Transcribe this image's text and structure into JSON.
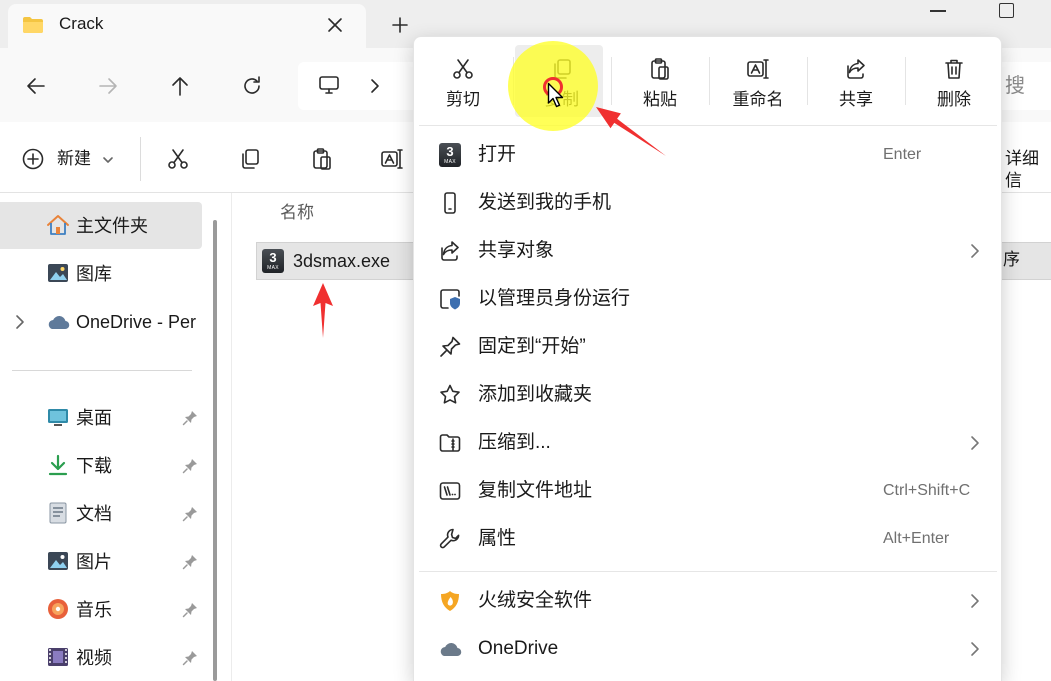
{
  "window": {
    "tab_title": "Crack"
  },
  "nav": {
    "search_placeholder": "搜"
  },
  "toolbar": {
    "new_label": "新建",
    "details_label": "详细信"
  },
  "sidebar": {
    "home": "主文件夹",
    "gallery": "图库",
    "onedrive": "OneDrive - Per",
    "pinned": [
      {
        "label": "桌面",
        "icon": "desktop-icon"
      },
      {
        "label": "下载",
        "icon": "download-icon"
      },
      {
        "label": "文档",
        "icon": "documents-icon"
      },
      {
        "label": "图片",
        "icon": "pictures-icon"
      },
      {
        "label": "音乐",
        "icon": "music-icon"
      },
      {
        "label": "视频",
        "icon": "videos-icon"
      }
    ]
  },
  "content": {
    "column_name": "名称",
    "file": {
      "name": "3dsmax.exe",
      "icon_digit": "3",
      "icon_caption": "MAX"
    },
    "type_fragment": "序"
  },
  "context_menu": {
    "top_actions": [
      {
        "label": "剪切",
        "icon": "scissors-icon"
      },
      {
        "label": "复制",
        "icon": "copy-icon",
        "hovered": true
      },
      {
        "label": "粘贴",
        "icon": "paste-icon"
      },
      {
        "label": "重命名",
        "icon": "rename-icon"
      },
      {
        "label": "共享",
        "icon": "share-icon"
      },
      {
        "label": "删除",
        "icon": "delete-icon"
      }
    ],
    "items": [
      {
        "label": "打开",
        "shortcut": "Enter",
        "icon": "3dsmax-app-icon"
      },
      {
        "label": "发送到我的手机",
        "icon": "phone-icon"
      },
      {
        "label": "共享对象",
        "icon": "share-icon",
        "submenu": true
      },
      {
        "label": "以管理员身份运行",
        "icon": "shield-admin-icon"
      },
      {
        "label": "固定到“开始”",
        "icon": "pin-icon"
      },
      {
        "label": "添加到收藏夹",
        "icon": "star-icon"
      },
      {
        "label": "压缩到...",
        "icon": "zip-folder-icon",
        "submenu": true
      },
      {
        "label": "复制文件地址",
        "shortcut": "Ctrl+Shift+C",
        "icon": "copy-path-icon"
      },
      {
        "label": "属性",
        "shortcut": "Alt+Enter",
        "icon": "wrench-icon"
      },
      {
        "label": "火绒安全软件",
        "icon": "huorong-icon",
        "submenu": true
      },
      {
        "label": "OneDrive",
        "icon": "onedrive-cloud-icon",
        "submenu": true
      }
    ]
  },
  "colors": {
    "selection_bg": "#e5e5e5",
    "cursor_highlight": "#ffff28",
    "annotation_red": "#f03030"
  }
}
